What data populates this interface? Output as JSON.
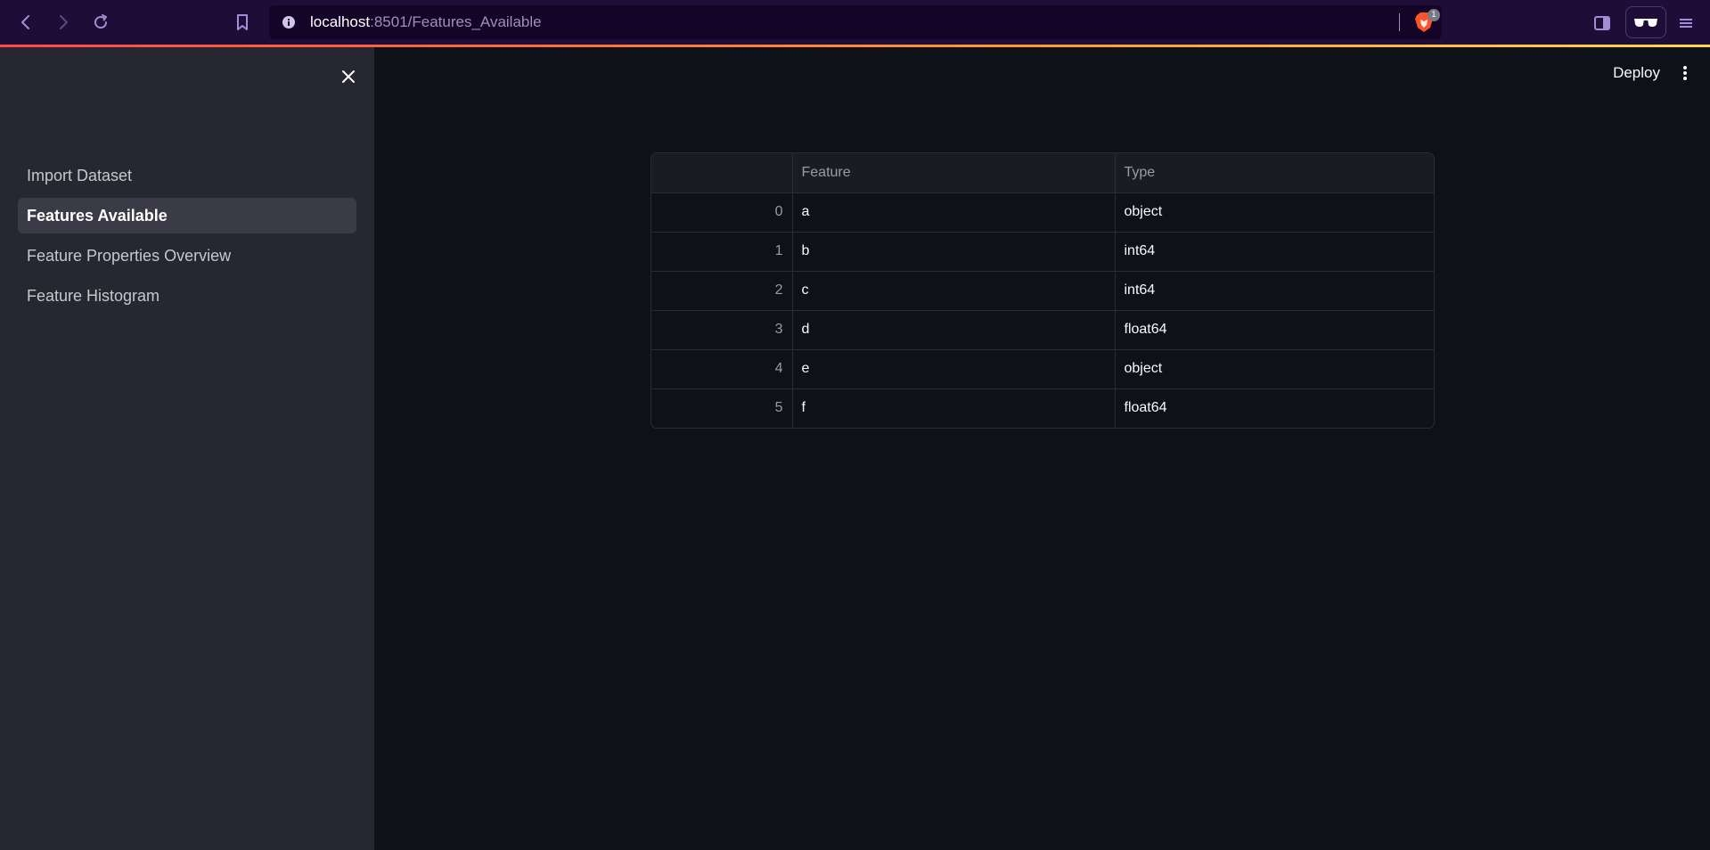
{
  "browser": {
    "url_host": "localhost",
    "url_path": ":8501/Features_Available",
    "brave_badge_count": "1"
  },
  "sidebar": {
    "items": [
      {
        "label": "Import Dataset"
      },
      {
        "label": "Features Available"
      },
      {
        "label": "Feature Properties Overview"
      },
      {
        "label": "Feature Histogram"
      }
    ],
    "active_index": 1
  },
  "header": {
    "deploy_label": "Deploy"
  },
  "table": {
    "columns": [
      "",
      "Feature",
      "Type"
    ],
    "rows": [
      [
        "0",
        "a",
        "object"
      ],
      [
        "1",
        "b",
        "int64"
      ],
      [
        "2",
        "c",
        "int64"
      ],
      [
        "3",
        "d",
        "float64"
      ],
      [
        "4",
        "e",
        "object"
      ],
      [
        "5",
        "f",
        "float64"
      ]
    ]
  }
}
